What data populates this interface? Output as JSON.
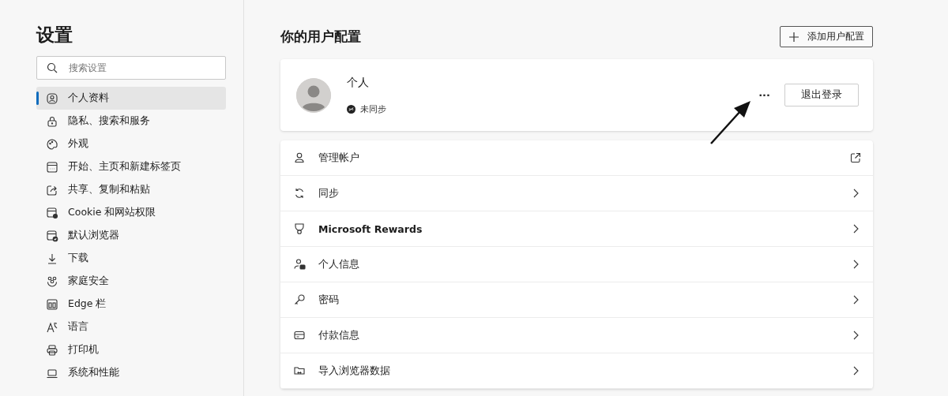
{
  "sidebar": {
    "title": "设置",
    "search": {
      "placeholder": "搜索设置"
    },
    "items": [
      {
        "label": "个人资料",
        "selected": true
      },
      {
        "label": "隐私、搜索和服务",
        "selected": false
      },
      {
        "label": "外观",
        "selected": false
      },
      {
        "label": "开始、主页和新建标签页",
        "selected": false
      },
      {
        "label": "共享、复制和粘贴",
        "selected": false
      },
      {
        "label": "Cookie 和网站权限",
        "selected": false
      },
      {
        "label": "默认浏览器",
        "selected": false
      },
      {
        "label": "下载",
        "selected": false
      },
      {
        "label": "家庭安全",
        "selected": false
      },
      {
        "label": "Edge 栏",
        "selected": false
      },
      {
        "label": "语言",
        "selected": false
      },
      {
        "label": "打印机",
        "selected": false
      },
      {
        "label": "系统和性能",
        "selected": false
      }
    ]
  },
  "main": {
    "title": "你的用户配置",
    "add_button": "添加用户配置",
    "profile": {
      "name": "个人",
      "sync_status": "未同步",
      "more": "···",
      "sign_out": "退出登录"
    },
    "rows": [
      {
        "label": "管理帐户",
        "kind": "external",
        "bold": false
      },
      {
        "label": "同步",
        "kind": "chevron",
        "bold": false
      },
      {
        "label": "Microsoft Rewards",
        "kind": "chevron",
        "bold": true
      },
      {
        "label": "个人信息",
        "kind": "chevron",
        "bold": false
      },
      {
        "label": "密码",
        "kind": "chevron",
        "bold": false
      },
      {
        "label": "付款信息",
        "kind": "chevron",
        "bold": false
      },
      {
        "label": "导入浏览器数据",
        "kind": "chevron",
        "bold": false
      }
    ]
  }
}
